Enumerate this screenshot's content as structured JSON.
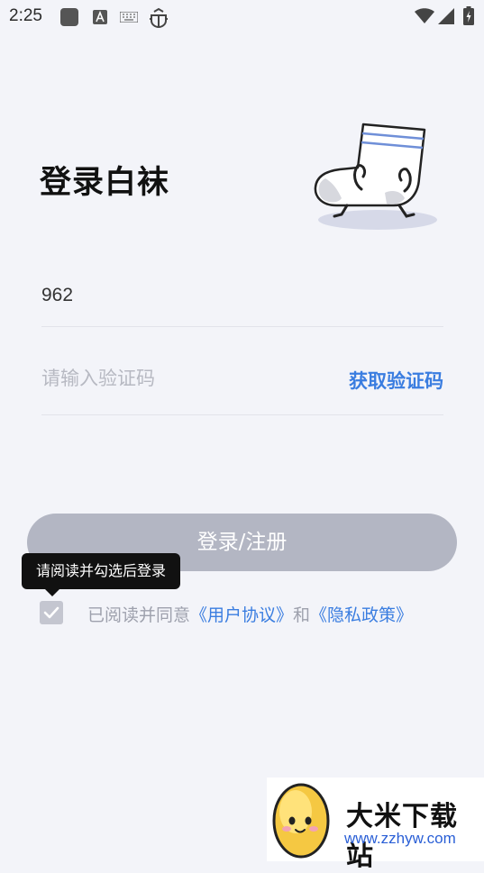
{
  "status_bar": {
    "time": "2:25",
    "left_icons": [
      "square-icon",
      "a-box-icon",
      "keyboard-icon",
      "bug-icon"
    ],
    "right_icons": [
      "wifi-icon",
      "signal-icon",
      "battery-icon"
    ]
  },
  "page": {
    "title": "登录白袜"
  },
  "form": {
    "phone_value": "962",
    "code_placeholder": "请输入验证码",
    "get_code_label": "获取验证码",
    "login_label": "登录/注册"
  },
  "tooltip": {
    "text": "请阅读并勾选后登录"
  },
  "agreement": {
    "prefix": "已阅读并同意",
    "user_agreement": "《用户协议》",
    "and": "和",
    "privacy_policy": "《隐私政策》"
  },
  "watermark": {
    "name": "大米下载站",
    "url": "www.zzhyw.com"
  },
  "colors": {
    "background": "#f3f4f9",
    "accent": "#3a7de0",
    "button_disabled": "#b3b6c3",
    "placeholder": "#b7b9c2",
    "tooltip_bg": "#111111"
  }
}
